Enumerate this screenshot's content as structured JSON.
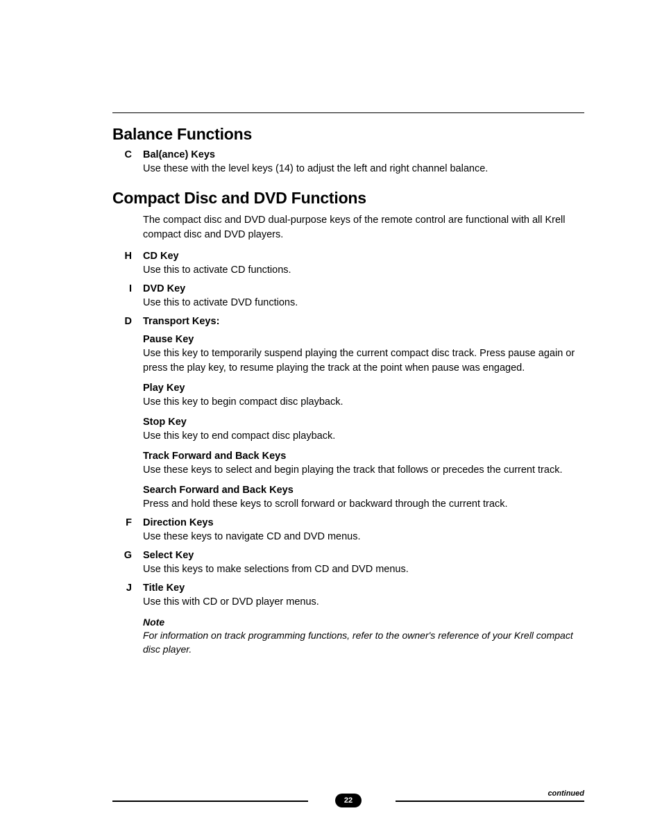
{
  "balanceFunctions": {
    "title": "Balance Functions",
    "items": [
      {
        "letter": "C",
        "name": "Bal(ance) Keys",
        "desc": "Use these with the level keys (14) to adjust the left and right channel balance."
      }
    ]
  },
  "cdDvdFunctions": {
    "title": "Compact Disc and DVD Functions",
    "intro": "The compact disc and DVD dual-purpose keys of the remote control are functional with all Krell compact disc and DVD players.",
    "items": [
      {
        "letter": "H",
        "name": "CD Key",
        "desc": "Use this to activate CD functions."
      },
      {
        "letter": "I",
        "name": "DVD Key",
        "desc": "Use this to activate DVD functions."
      },
      {
        "letter": "D",
        "name": "Transport Keys:",
        "subs": [
          {
            "head": "Pause Key",
            "desc": "Use this key to temporarily suspend playing the current compact disc track. Press pause again or press the play key, to resume playing the track at the point when pause was engaged."
          },
          {
            "head": "Play Key",
            "desc": "Use this key to begin compact disc playback."
          },
          {
            "head": "Stop Key",
            "desc": "Use this key to end compact disc playback."
          },
          {
            "head": "Track Forward and Back Keys",
            "desc": "Use these keys to select and begin playing the track that follows or precedes the current track."
          },
          {
            "head": "Search Forward and Back Keys",
            "desc": "Press and hold these keys to scroll forward or backward through the current track."
          }
        ]
      },
      {
        "letter": "F",
        "name": "Direction Keys",
        "desc": "Use these keys to navigate CD and DVD menus."
      },
      {
        "letter": "G",
        "name": "Select Key",
        "desc": "Use this keys to make selections from CD and DVD menus."
      },
      {
        "letter": "J",
        "name": "Title Key",
        "desc": "Use this with CD or DVD player menus."
      }
    ],
    "note": {
      "head": "Note",
      "body": "For information on track programming functions, refer to the owner's reference of your Krell compact disc player."
    }
  },
  "footer": {
    "page": "22",
    "continued": "continued"
  }
}
